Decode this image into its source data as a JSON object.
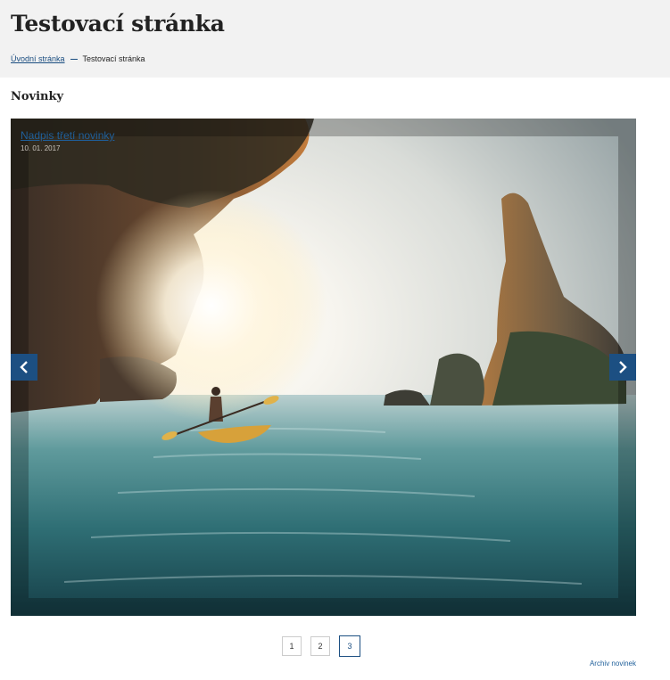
{
  "header": {
    "title": "Testovací stránka",
    "breadcrumb": [
      {
        "label": "Úvodní stránka"
      },
      {
        "label": "Testovací stránka"
      }
    ]
  },
  "news": {
    "section_title": "Novinky",
    "slide": {
      "title": "Nadpis třetí novinky",
      "date": "10. 01. 2017"
    },
    "prev_icon": "chevron-left-icon",
    "next_icon": "chevron-right-icon",
    "pages": [
      "1",
      "2",
      "3"
    ],
    "active_page": "3",
    "archive_label": "Archiv novinek"
  },
  "colors": {
    "accent": "#1c4f82",
    "link": "#1f5f9a",
    "header_bg": "#f2f2f2"
  }
}
